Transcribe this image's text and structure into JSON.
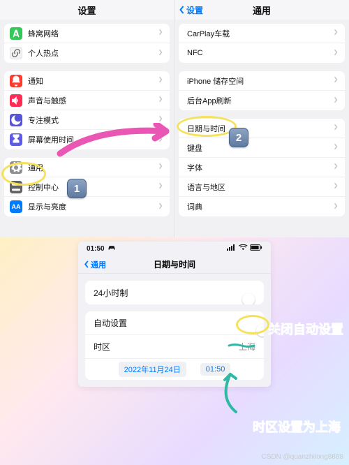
{
  "left": {
    "title": "设置",
    "group1": [
      {
        "icon": "antenna",
        "color": "ic-green",
        "label": "蜂窝网络"
      },
      {
        "icon": "link",
        "color": "ic-white",
        "label": "个人热点"
      }
    ],
    "group2": [
      {
        "icon": "bell",
        "color": "ic-red",
        "label": "通知"
      },
      {
        "icon": "speaker",
        "color": "ic-pink",
        "label": "声音与触感"
      },
      {
        "icon": "moon",
        "color": "ic-indigo",
        "label": "专注模式"
      },
      {
        "icon": "hourglass",
        "color": "ic-purple",
        "label": "屏幕使用时间"
      }
    ],
    "group3": [
      {
        "icon": "gear",
        "color": "ic-gray",
        "label": "通用"
      },
      {
        "icon": "switches",
        "color": "ic-dgray",
        "label": "控制中心"
      },
      {
        "icon": "aa",
        "color": "ic-blue",
        "label": "显示与亮度"
      }
    ]
  },
  "right": {
    "back": "设置",
    "title": "通用",
    "group0": [
      "CarPlay车载",
      "NFC"
    ],
    "group1": [
      "iPhone 储存空间",
      "后台App刷新"
    ],
    "group2": [
      "日期与时间",
      "键盘",
      "字体",
      "语言与地区",
      "词典"
    ]
  },
  "annotations": {
    "badge1": "1",
    "badge2": "2"
  },
  "bottom": {
    "status_time": "01:50",
    "back": "通用",
    "title": "日期与时间",
    "row_24h": "24小时制",
    "row_auto": "自动设置",
    "row_tz": "时区",
    "tz_value": "上海",
    "date_chip": "2022年11月24日",
    "time_chip": "01:50",
    "handtext1": "关闭自动设置",
    "handtext2": "时区设置为上海"
  },
  "watermark": "CSDN @quanzhilong8888"
}
